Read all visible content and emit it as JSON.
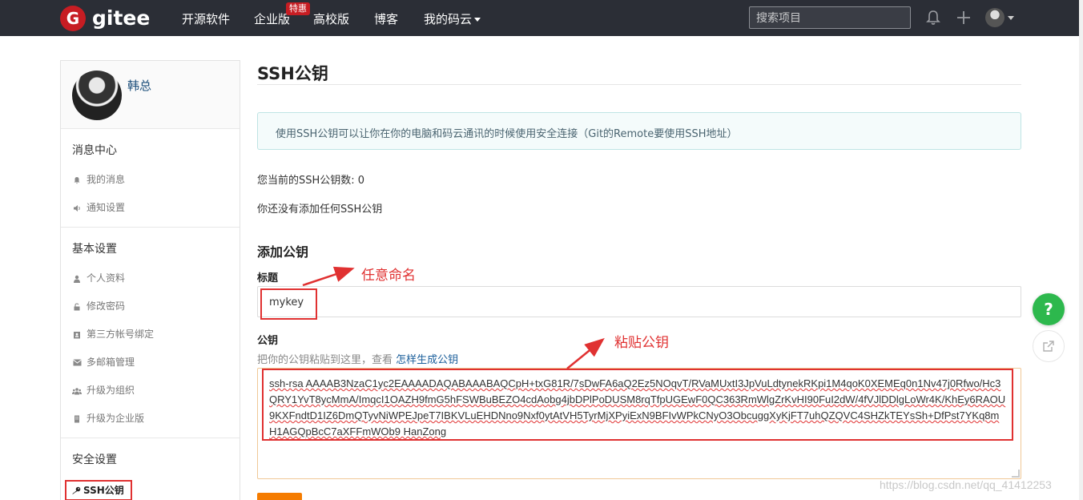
{
  "nav": {
    "logo_text": "gitee",
    "logo_mark": "G",
    "items": [
      "开源软件",
      "企业版",
      "高校版",
      "博客",
      "我的码云"
    ],
    "badge": "特惠",
    "search_placeholder": "搜索项目"
  },
  "icons": {
    "bell": "bell-icon",
    "plus": "plus-icon",
    "help": "question-icon",
    "share": "share-icon"
  },
  "sidebar": {
    "user_name": "韩总",
    "sections": [
      {
        "heading": "消息中心",
        "items": [
          "我的消息",
          "通知设置"
        ]
      },
      {
        "heading": "基本设置",
        "items": [
          "个人资料",
          "修改密码",
          "第三方帐号绑定",
          "多邮箱管理",
          "升级为组织",
          "升级为企业版"
        ]
      },
      {
        "heading": "安全设置",
        "items": [
          "SSH公钥"
        ]
      }
    ]
  },
  "main": {
    "title": "SSH公钥",
    "info": "使用SSH公钥可以让你在你的电脑和码云通讯的时候使用安全连接（Git的Remote要使用SSH地址）",
    "count_text": "您当前的SSH公钥数: 0",
    "none_text": "你还没有添加任何SSH公钥",
    "add_heading": "添加公钥",
    "title_label": "标题",
    "title_value": "mykey",
    "key_label": "公钥",
    "key_hint": "把你的公钥粘贴到这里，查看",
    "key_hint_link": "怎样生成公钥",
    "key_value": "ssh-rsa AAAAB3NzaC1yc2EAAAADAQABAAABAQCpH+txG81R/7sDwFA6aQ2Ez5NOqvT/RVaMUxtI3JpVuLdtynekRKpi1M4qoK0XEMEq0n1Nv47j0Rfwo/Hc3QRY1YvT8ycMmA/ImqcI1OAZH9fmG5hFSWBuBEZO4cdAobg4jbDPlPoDUSM8rqTfpUGEwF0QC363RmWlgZrKvHI90FuI2dW/4fVJlDDlgLoWr4K/KhEy6RAOU9KXFndtD1IZ6DmQTyvNiWPEJpeT7IBKVLuEHDNno9Nxf0ytAtVH5TyrMjXPyiExN9BFIvWPkCNyO3ObcuggXyKjFT7uhQZQVC4SHZkTEYsSh+DfPst7YKq8mH1AGQpBcC7aXFFmWOb9 HanZong"
  },
  "annotations": {
    "name_note": "任意命名",
    "paste_note": "粘贴公钥"
  },
  "floating": {
    "help_label": "?"
  },
  "watermark": "https://blog.csdn.net/qq_41412253",
  "colors": {
    "topbar": "#2b2e36",
    "brand_red": "#c71d23",
    "annotation_red": "#e03131",
    "help_green": "#2db84d",
    "submit_orange": "#f57c00"
  }
}
